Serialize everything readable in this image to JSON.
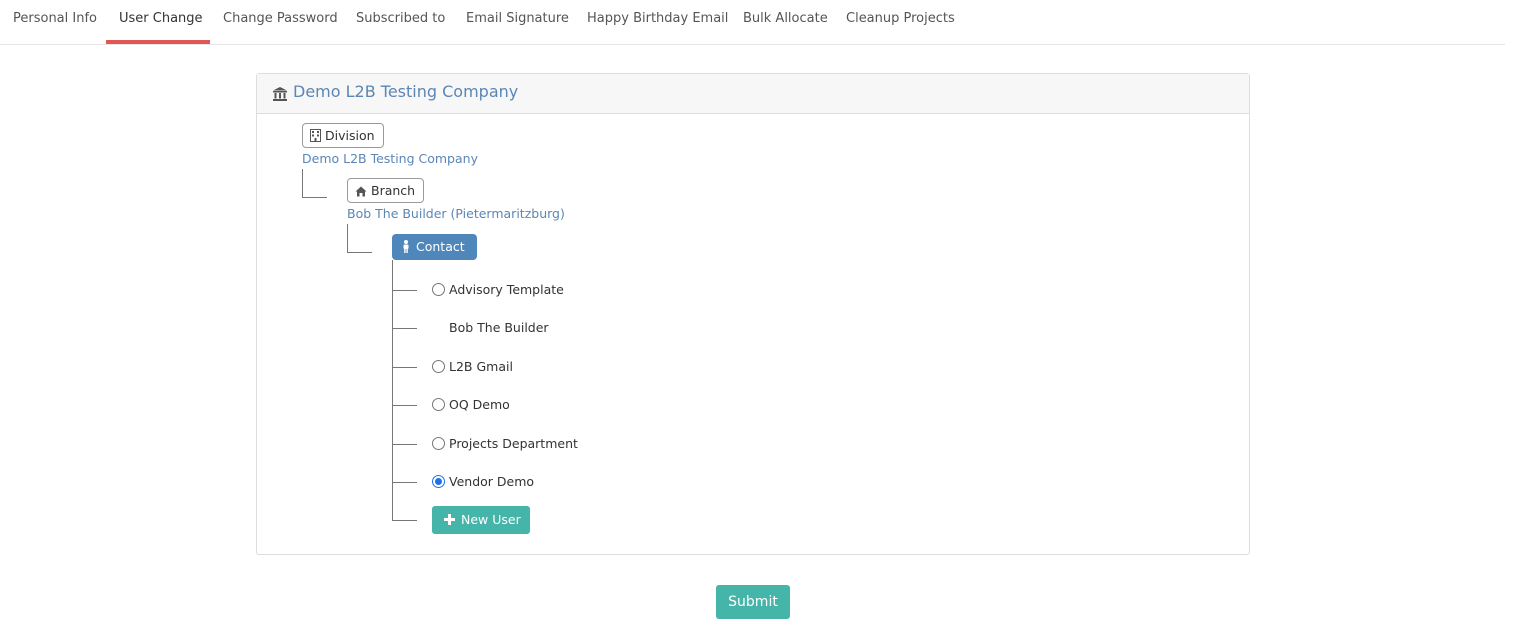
{
  "tabs": [
    {
      "label": "Personal Info"
    },
    {
      "label": "User Change",
      "active": true
    },
    {
      "label": "Change Password"
    },
    {
      "label": "Subscribed to"
    },
    {
      "label": "Email Signature"
    },
    {
      "label": "Happy Birthday Email"
    },
    {
      "label": "Bulk Allocate"
    },
    {
      "label": "Cleanup Projects"
    }
  ],
  "panel": {
    "title": "Demo L2B Testing Company",
    "icon": "bank-icon"
  },
  "tree": {
    "division": {
      "label": "Division",
      "icon": "building-icon",
      "name": "Demo L2B Testing Company"
    },
    "branch": {
      "label": "Branch",
      "icon": "home-icon",
      "name": "Bob The Builder (Pietermaritzburg)"
    },
    "contact": {
      "label": "Contact",
      "icon": "person-icon"
    },
    "users": [
      {
        "name": "Advisory Template",
        "radio": true,
        "checked": false
      },
      {
        "name": "Bob The Builder",
        "radio": false,
        "checked": false
      },
      {
        "name": "L2B Gmail",
        "radio": true,
        "checked": false
      },
      {
        "name": "OQ Demo",
        "radio": true,
        "checked": false
      },
      {
        "name": "Projects Department",
        "radio": true,
        "checked": false
      },
      {
        "name": "Vendor Demo",
        "radio": true,
        "checked": true
      }
    ],
    "new_user_label": "New User"
  },
  "submit_label": "Submit",
  "colors": {
    "accent_red": "#e45555",
    "link_blue": "#5b86b5",
    "contact_blue": "#4f87bb",
    "teal": "#45b5a9"
  }
}
